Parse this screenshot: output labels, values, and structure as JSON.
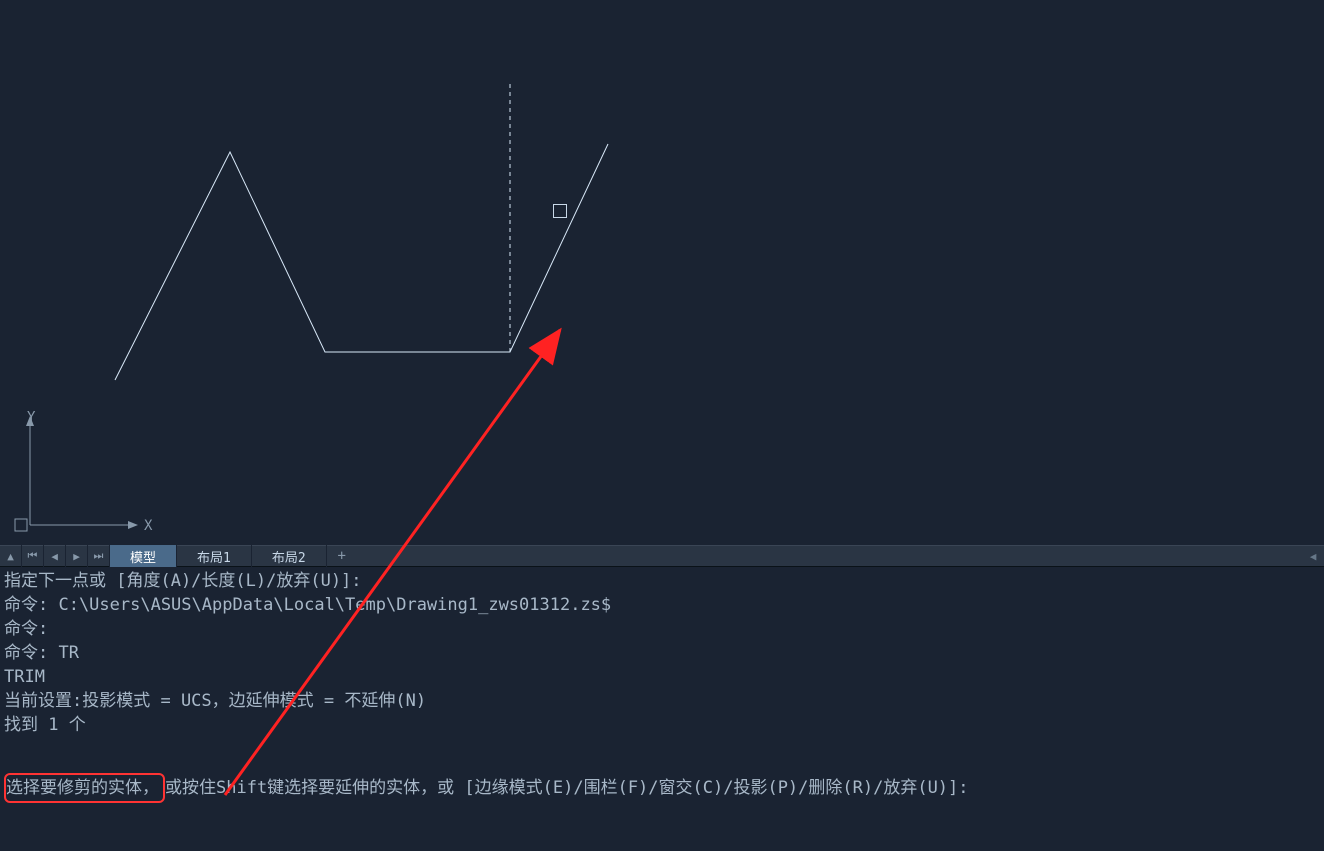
{
  "tabs": {
    "model": "模型",
    "layout1": "布局1",
    "layout2": "布局2"
  },
  "ucs": {
    "x_label": "X",
    "y_label": "Y"
  },
  "command_history": {
    "line1": "指定下一点或 [角度(A)/长度(L)/放弃(U)]:",
    "line2": "命令: C:\\Users\\ASUS\\AppData\\Local\\Temp\\Drawing1_zws01312.zs$",
    "line3": "命令:",
    "line4": "命令:  TR",
    "line5": "TRIM",
    "line6": "当前设置:投影模式 = UCS，边延伸模式 = 不延伸(N)",
    "line7": "找到 1 个"
  },
  "prompt": {
    "highlighted": "选择要修剪的实体，",
    "rest": "或按住Shift键选择要延伸的实体，或 [边缘模式(E)/围栏(F)/窗交(C)/投影(P)/删除(R)/放弃(U)]:"
  }
}
